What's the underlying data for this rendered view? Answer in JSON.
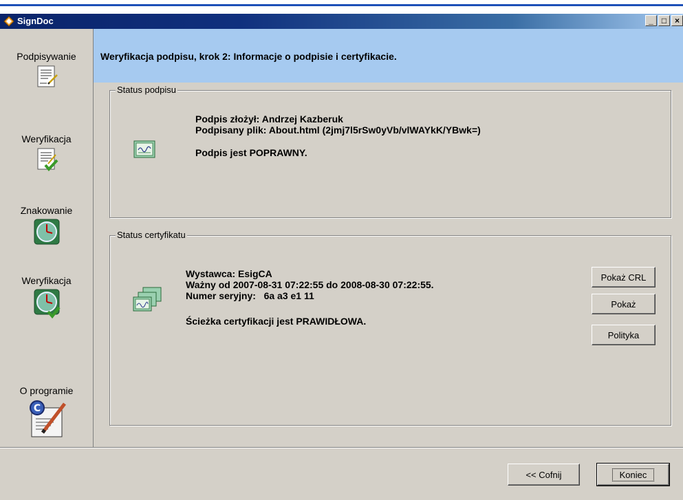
{
  "window": {
    "title": "SignDoc",
    "controls": [
      "_",
      "□",
      "×"
    ]
  },
  "sidebar": {
    "items": [
      {
        "label": "Podpisywanie",
        "icon": "document-sign-icon"
      },
      {
        "label": "Weryfikacja",
        "icon": "document-verify-icon"
      },
      {
        "label": "Znakowanie",
        "icon": "clock-icon"
      },
      {
        "label": "Weryfikacja",
        "icon": "clock-verify-icon"
      },
      {
        "label": "O programie",
        "icon": "about-certificate-icon"
      }
    ]
  },
  "header": {
    "title": "Weryfikacja podpisu, krok 2: Informacje o podpisie i certyfikacie."
  },
  "signature_status": {
    "legend": "Status podpisu",
    "signer": "Podpis złożył: Andrzej Kazberuk",
    "file": "Podpisany plik: About.html (2jmj7l5rSw0yVb/vlWAYkK/YBwk=)",
    "result": "Podpis jest POPRAWNY."
  },
  "certificate_status": {
    "legend": "Status certyfikatu",
    "issuer": "Wystawca: EsigCA",
    "validity": "Ważny od 2007-08-31 07:22:55 do 2008-08-30 07:22:55.",
    "serial": "Numer seryjny:   6a a3 e1 11",
    "path": "Ścieżka certyfikacji jest PRAWIDŁOWA.",
    "buttons": {
      "crl": "Pokaż CRL",
      "show": "Pokaż",
      "policy": "Polityka"
    }
  },
  "footer": {
    "back": "<< Cofnij",
    "finish": "Koniec"
  }
}
